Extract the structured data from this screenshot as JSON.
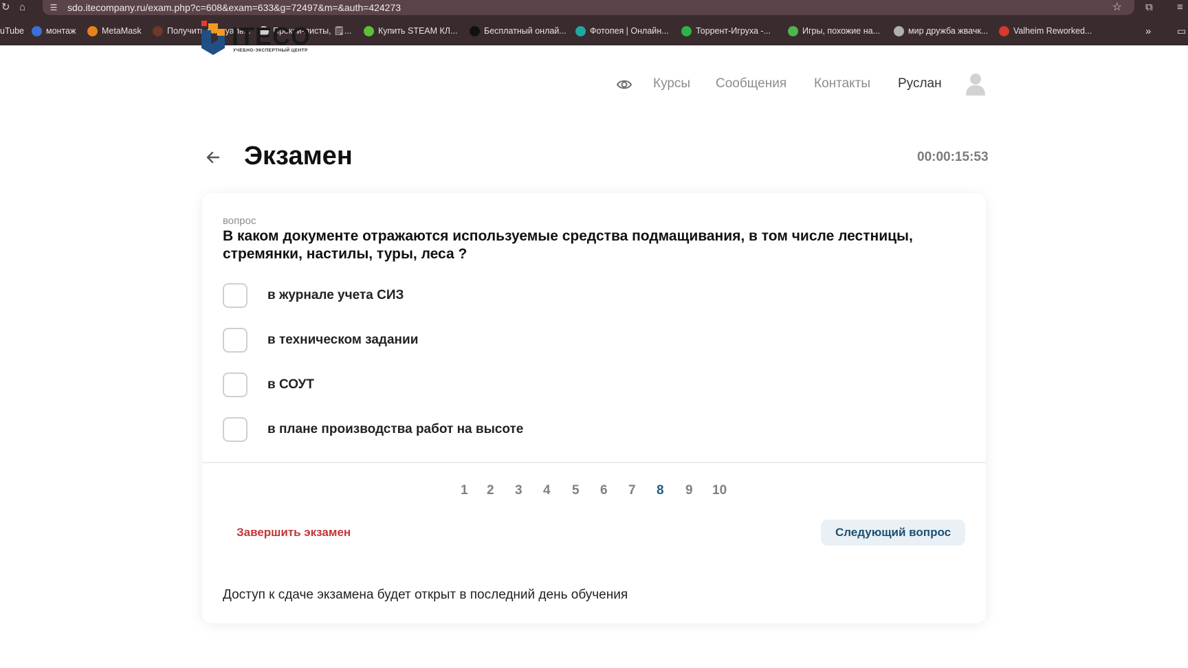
{
  "browser": {
    "url": "sdo.itecompany.ru/exam.php?c=608&exam=633&g=72497&m=&auth=424273",
    "bookmarks": [
      {
        "label": "uTube",
        "color": "#d94040"
      },
      {
        "label": "монтаж",
        "color": "#3a6fd8"
      },
      {
        "label": "MetaMask",
        "color": "#e8821e"
      },
      {
        "label": "Получить виртуаль...",
        "color": "#6b3a2a"
      },
      {
        "label": "Прокси-листы, 🗒...",
        "color": "#cfcfcf"
      },
      {
        "label": "Купить STEAM КЛ...",
        "color": "#5bbf3a"
      },
      {
        "label": "Бесплатный онлай...",
        "color": "#111111"
      },
      {
        "label": "Фотопея | Онлайн...",
        "color": "#20a8a0"
      },
      {
        "label": "Торрент-Игруха -...",
        "color": "#2db34a"
      },
      {
        "label": "Игры, похожие на...",
        "color": "#4cb84c"
      },
      {
        "label": "мир дружба жвачк...",
        "color": "#b0b0b0"
      },
      {
        "label": "Valheim Reworked...",
        "color": "#d53a2a"
      }
    ]
  },
  "header": {
    "logo_text": "ITECO",
    "logo_subtitle": "УЧЕБНО-ЭКСПЕРТНЫЙ ЦЕНТР",
    "nav": {
      "courses": "Курсы",
      "messages": "Сообщения",
      "contacts": "Контакты",
      "user": "Руслан"
    }
  },
  "page": {
    "title": "Экзамен",
    "timer": "00:00:15:53"
  },
  "question": {
    "label": "вопрос",
    "text": "В каком документе отражаются используемые средства подмащивания, в том числе лестницы, стремянки, настилы, туры, леса ?",
    "options": [
      {
        "label": "в журнале учета СИЗ",
        "checked": false
      },
      {
        "label": "в техническом задании",
        "checked": false
      },
      {
        "label": "в СОУТ",
        "checked": false
      },
      {
        "label": "в плане производства работ на высоте",
        "checked": false
      }
    ]
  },
  "pagination": {
    "pages": [
      "1",
      "2",
      "3",
      "4",
      "5",
      "6",
      "7",
      "8",
      "9",
      "10"
    ],
    "current": "8"
  },
  "actions": {
    "finish_label": "Завершить экзамен",
    "next_label": "Следующий вопрос"
  },
  "notice": "Доступ к сдаче экзамена будет открыт в последний день обучения",
  "colors": {
    "accent": "#1e5b7e",
    "danger": "#c43535",
    "button_bg": "#e9f1f6",
    "muted": "#8c8c8c"
  }
}
